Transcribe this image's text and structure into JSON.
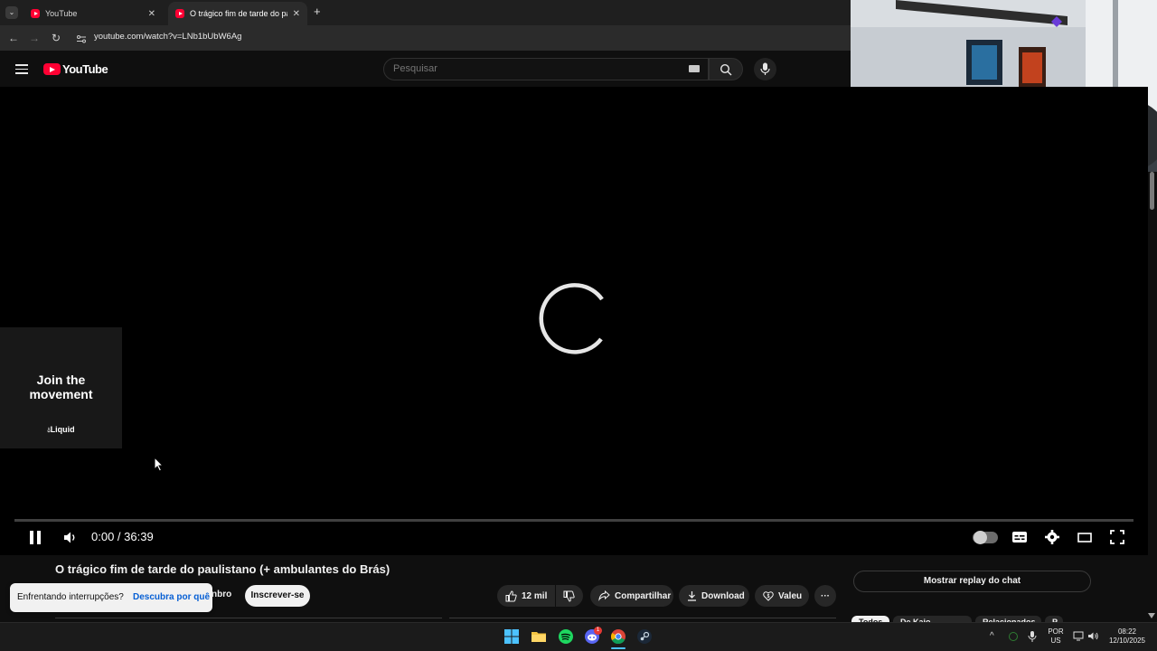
{
  "browser": {
    "tabs": [
      {
        "title": "YouTube",
        "active": false
      },
      {
        "title": "O trágico fim de tarde do paulistano",
        "active": true
      }
    ],
    "new_tab_label": "+",
    "url": "youtube.com/watch?v=LNb1bUbW6Ag"
  },
  "youtube": {
    "logo_text": "YouTube",
    "search_placeholder": "Pesquisar"
  },
  "player": {
    "ad_card_text_line1": "Join the",
    "ad_card_text_line2": "movement",
    "ad_brand": "Liquid",
    "time_current": "0:00",
    "time_separator": " / ",
    "time_total": "36:39",
    "progress_fraction": 0.0,
    "state": "loading"
  },
  "video": {
    "title": "O trágico fim de tarde do paulistano (+ ambulantes do Brás)",
    "member_label": "nbro",
    "subscribe_label": "Inscrever-se",
    "likes": "12 mil",
    "share_label": "Compartilhar",
    "download_label": "Download",
    "thanks_label": "Valeu",
    "more_label": "···"
  },
  "toast": {
    "text": "Enfrentando interrupções?",
    "link": "Descubra por quê"
  },
  "sidebar": {
    "chat_replay_label": "Mostrar replay do chat",
    "chips": [
      "Todos",
      "De Kaio D'Elaqua",
      "Relacionados",
      "P"
    ]
  },
  "taskbar": {
    "lang_line1": "POR",
    "lang_line2": "US",
    "clock_time": "08:22",
    "clock_date": "12/10/2025",
    "discord_badge": "1"
  },
  "colors": {
    "youtube_red": "#ff0033",
    "background": "#0f0f0f",
    "toast_link": "#065fd4"
  }
}
